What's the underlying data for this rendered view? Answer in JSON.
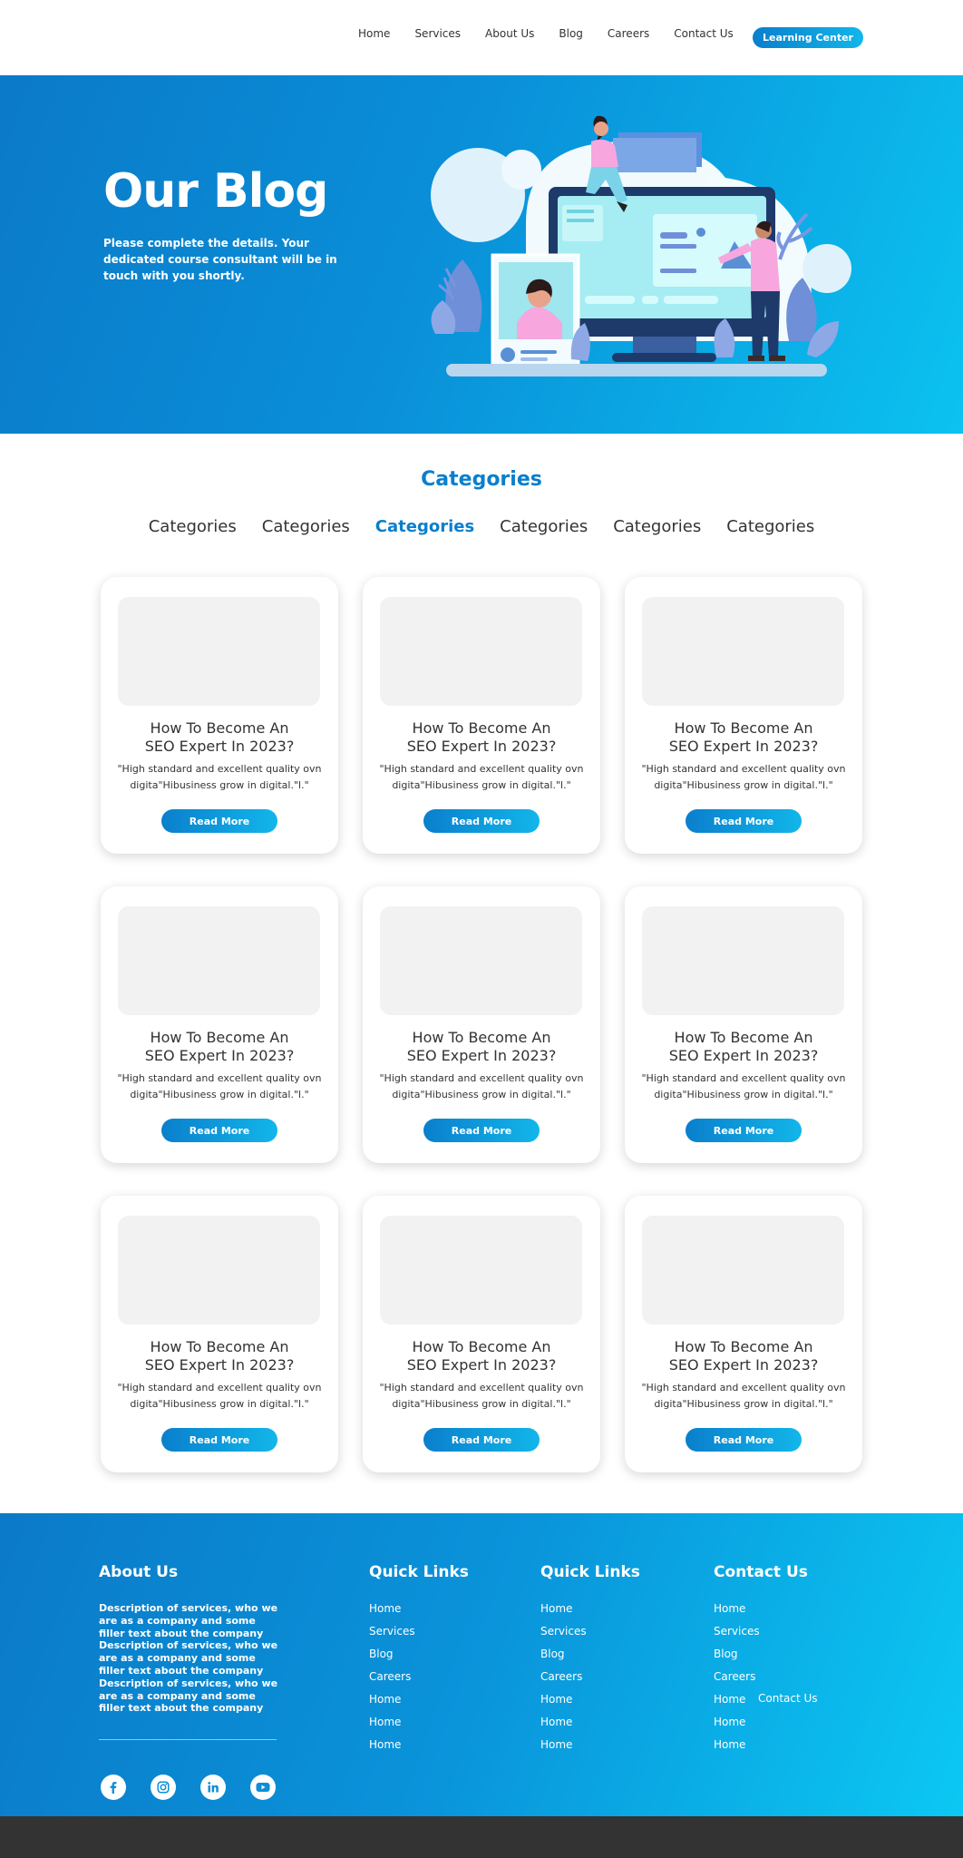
{
  "nav": {
    "links": [
      "Home",
      "Services",
      "About Us",
      "Blog",
      "Careers",
      "Contact Us"
    ],
    "cta": "Learning Center"
  },
  "hero": {
    "title": "Our Blog",
    "subtitle": "Please complete the details. Your dedicated course consultant will be in touch with you shortly."
  },
  "categories": {
    "heading": "Categories",
    "tabs": [
      "Categories",
      "Categories",
      "Categories",
      "Categories",
      "Categories",
      "Categories"
    ],
    "active_index": 2
  },
  "cards": [
    {
      "title": "How To Become An SEO Expert In 2023?",
      "text": "\"High standard and excellent quality ovn digita\"Hibusiness grow in digital.\"l.\"",
      "button": "Read More"
    },
    {
      "title": "How To Become An SEO Expert In 2023?",
      "text": "\"High standard and excellent quality ovn digita\"Hibusiness grow in digital.\"l.\"",
      "button": "Read More"
    },
    {
      "title": "How To Become An SEO Expert In 2023?",
      "text": "\"High standard and excellent quality ovn digita\"Hibusiness grow in digital.\"l.\"",
      "button": "Read More"
    },
    {
      "title": "How To Become An SEO Expert In 2023?",
      "text": "\"High standard and excellent quality ovn digita\"Hibusiness grow in digital.\"l.\"",
      "button": "Read More"
    },
    {
      "title": "How To Become An SEO Expert In 2023?",
      "text": "\"High standard and excellent quality ovn digita\"Hibusiness grow in digital.\"l.\"",
      "button": "Read More"
    },
    {
      "title": "How To Become An SEO Expert In 2023?",
      "text": "\"High standard and excellent quality ovn digita\"Hibusiness grow in digital.\"l.\"",
      "button": "Read More"
    },
    {
      "title": "How To Become An SEO Expert In 2023?",
      "text": "\"High standard and excellent quality ovn digita\"Hibusiness grow in digital.\"l.\"",
      "button": "Read More"
    },
    {
      "title": "How To Become An SEO Expert In 2023?",
      "text": "\"High standard and excellent quality ovn digita\"Hibusiness grow in digital.\"l.\"",
      "button": "Read More"
    },
    {
      "title": "How To Become An SEO Expert In 2023?",
      "text": "\"High standard and excellent quality ovn digita\"Hibusiness grow in digital.\"l.\"",
      "button": "Read More"
    }
  ],
  "footer": {
    "about": {
      "heading": "About Us",
      "text": "Description of services, who we are as a company and some filler text about the company Description of services, who we are as a company and some filler text about the company Description of services, who we are as a company and some filler text about the company"
    },
    "columns": [
      {
        "heading": "Quick Links",
        "items": [
          "Home",
          "Services",
          "Blog",
          "Careers",
          "Home",
          "Home",
          "Home"
        ]
      },
      {
        "heading": "Quick Links",
        "items": [
          "Home",
          "Services",
          "Blog",
          "Careers",
          "Home",
          "Home",
          "Home"
        ]
      },
      {
        "heading": "Contact Us",
        "items": [
          "Home",
          "Services",
          "Blog",
          "Careers",
          "Home",
          "Home",
          "Home"
        ]
      }
    ],
    "contact_extra": "Contact Us",
    "social_icons": [
      "facebook-icon",
      "instagram-icon",
      "linkedin-icon",
      "youtube-icon"
    ]
  },
  "colors": {
    "primary": "#0a7fcc",
    "accent": "#12b6ea",
    "text": "#333333",
    "bottom_bar": "#333333"
  }
}
